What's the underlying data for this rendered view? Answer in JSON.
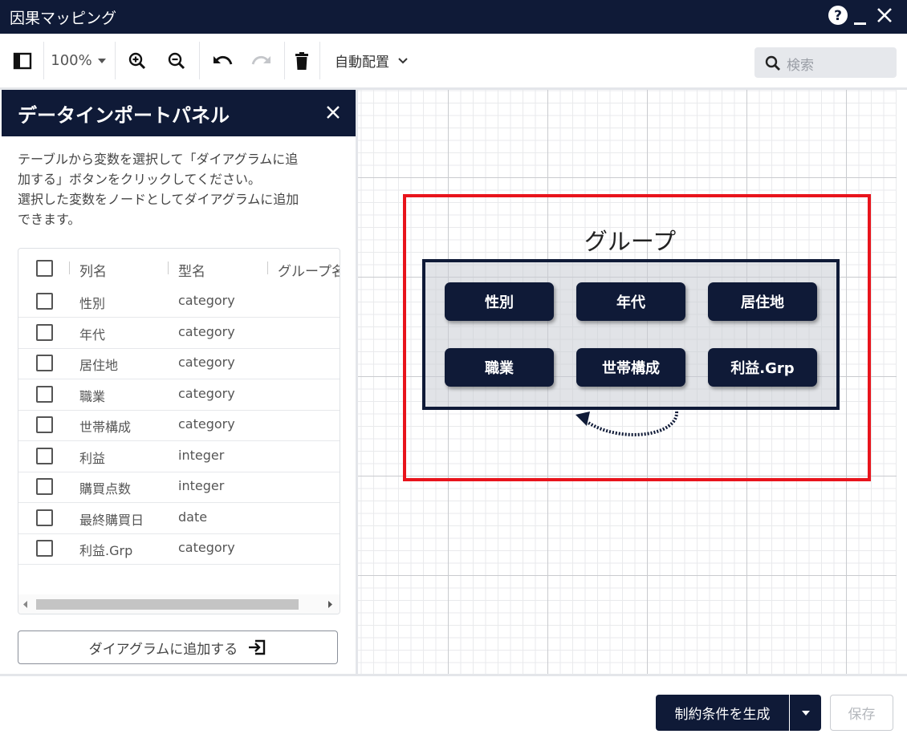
{
  "window": {
    "title": "因果マッピング"
  },
  "toolbar": {
    "zoom": "100%",
    "auto_layout": "自動配置",
    "search_placeholder": "検索"
  },
  "panel": {
    "title": "データインポートパネル",
    "description": [
      "テーブルから変数を選択して「ダイアグラムに追",
      "加する」ボタンをクリックしてください。",
      "選択した変数をノードとしてダイアグラムに追加",
      "できます。"
    ],
    "columns": [
      "列名",
      "型名",
      "グループ名"
    ],
    "rows": [
      {
        "name": "性別",
        "type": "category"
      },
      {
        "name": "年代",
        "type": "category"
      },
      {
        "name": "居住地",
        "type": "category"
      },
      {
        "name": "職業",
        "type": "category"
      },
      {
        "name": "世帯構成",
        "type": "category"
      },
      {
        "name": "利益",
        "type": "integer"
      },
      {
        "name": "購買点数",
        "type": "integer"
      },
      {
        "name": "最終購買日",
        "type": "date"
      },
      {
        "name": "利益.Grp",
        "type": "category"
      }
    ],
    "add_button": "ダイアグラムに追加する"
  },
  "diagram": {
    "group_label": "グループ",
    "nodes": [
      "性別",
      "年代",
      "居住地",
      "職業",
      "世帯構成",
      "利益.Grp"
    ]
  },
  "footer": {
    "generate": "制約条件を生成",
    "save": "保存"
  },
  "colors": {
    "navy": "#0f1a37",
    "highlight": "#e8141c"
  }
}
